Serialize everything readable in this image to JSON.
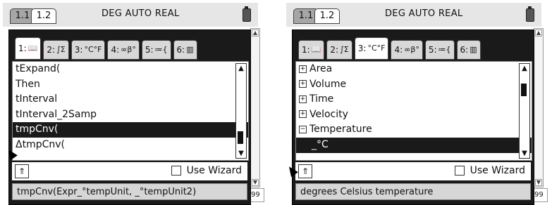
{
  "screens": [
    {
      "tabs": [
        "1.1",
        "1.2"
      ],
      "status": "DEG AUTO REAL",
      "catalog_tabs": [
        {
          "num": "1:",
          "icon": "book-icon"
        },
        {
          "num": "2:",
          "label": "∫Σ"
        },
        {
          "num": "3:",
          "label": "°C°F"
        },
        {
          "num": "4:",
          "label": "∞β°"
        },
        {
          "num": "5:",
          "label": "≔{"
        },
        {
          "num": "6:",
          "icon": "library-icon"
        }
      ],
      "active_tab": 0,
      "items": [
        {
          "label": "tExpand("
        },
        {
          "label": "Then"
        },
        {
          "label": "tInterval"
        },
        {
          "label": "tInterval_2Samp"
        },
        {
          "label": "tmpCnv(",
          "selected": true
        },
        {
          "label": "ΔtmpCnv("
        }
      ],
      "wizard_label": "Use Wizard",
      "help_text": "tmpCnv(Expr_°tempUnit, _°tempUnit2)",
      "edge_text": "99"
    },
    {
      "tabs": [
        "1.1",
        "1.2"
      ],
      "status": "DEG AUTO REAL",
      "catalog_tabs": [
        {
          "num": "1:",
          "icon": "book-icon"
        },
        {
          "num": "2:",
          "label": "∫Σ"
        },
        {
          "num": "3:",
          "label": "°C°F"
        },
        {
          "num": "4:",
          "label": "∞β°"
        },
        {
          "num": "5:",
          "label": "≔{"
        },
        {
          "num": "6:",
          "icon": "library-icon"
        }
      ],
      "active_tab": 2,
      "items": [
        {
          "label": "Area",
          "tree": "+"
        },
        {
          "label": "Volume",
          "tree": "+"
        },
        {
          "label": "Time",
          "tree": "+"
        },
        {
          "label": "Velocity",
          "tree": "+"
        },
        {
          "label": "Temperature",
          "tree": "−"
        },
        {
          "label": "_°C",
          "selected": true,
          "child": true
        }
      ],
      "wizard_label": "Use Wizard",
      "help_text": "degrees Celsius temperature",
      "edge_text": "99"
    }
  ]
}
